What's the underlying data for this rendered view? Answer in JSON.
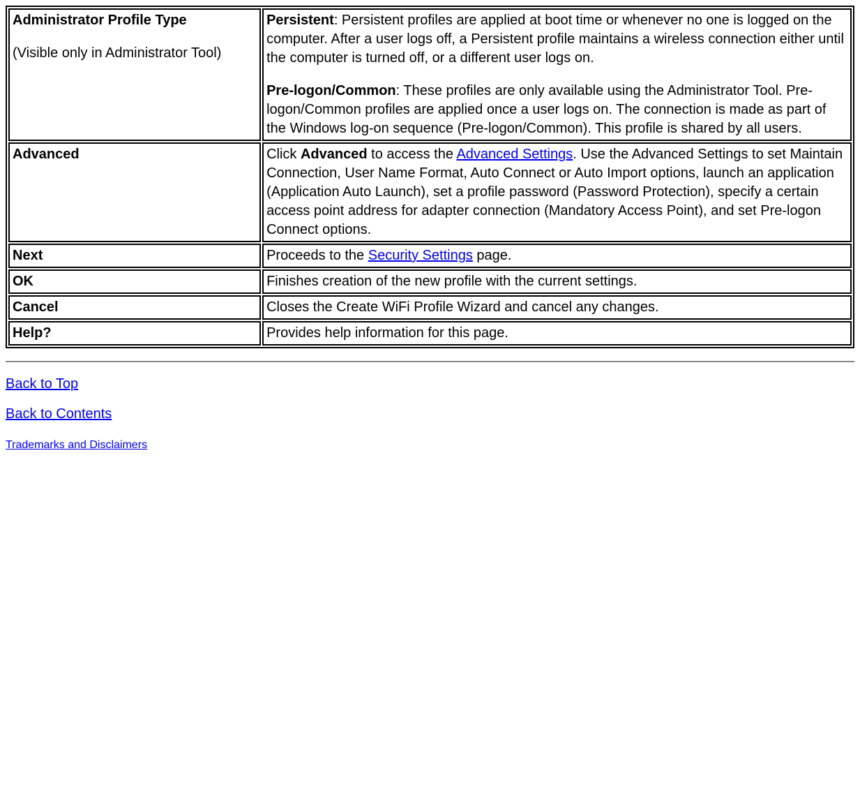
{
  "rows": {
    "r0": {
      "label_bold": "Administrator Profile Type",
      "label_note": "(Visible only in Administrator Tool)",
      "desc_p1_bold": "Persistent",
      "desc_p1_rest": ": Persistent profiles are applied at boot time or whenever no one is logged on the computer. After a user logs off, a Persistent profile maintains a wireless connection either until the computer is turned off, or a different user logs on.",
      "desc_p2_bold": "Pre-logon/Common",
      "desc_p2_rest": ": These profiles are only available using the Administrator Tool. Pre-logon/Common profiles are applied once a user logs on. The connection is made as part of the Windows log-on sequence (Pre-logon/Common). This profile is shared by all users."
    },
    "r1": {
      "label_bold": "Advanced",
      "desc_pre": "Click ",
      "desc_bold": "Advanced",
      "desc_mid": " to access the ",
      "desc_link": "Advanced Settings",
      "desc_post": ". Use the Advanced Settings to set Maintain Connection, User Name Format, Auto Connect or Auto Import options, launch an application (Application Auto Launch), set a profile password (Password Protection), specify a certain access point address for adapter connection (Mandatory Access Point), and set Pre-logon Connect options."
    },
    "r2": {
      "label_bold": "Next",
      "desc_pre": "Proceeds to the ",
      "desc_link": "Security Settings",
      "desc_post": " page."
    },
    "r3": {
      "label_bold": "OK",
      "desc": "Finishes creation of the new profile with the current settings."
    },
    "r4": {
      "label_bold": "Cancel",
      "desc": "Closes the Create WiFi Profile Wizard and cancel any changes."
    },
    "r5": {
      "label_bold": "Help?",
      "desc": "Provides help information for this page."
    }
  },
  "footer": {
    "back_top": "Back to Top",
    "back_contents": "Back to Contents",
    "trademarks": "Trademarks and Disclaimers"
  }
}
